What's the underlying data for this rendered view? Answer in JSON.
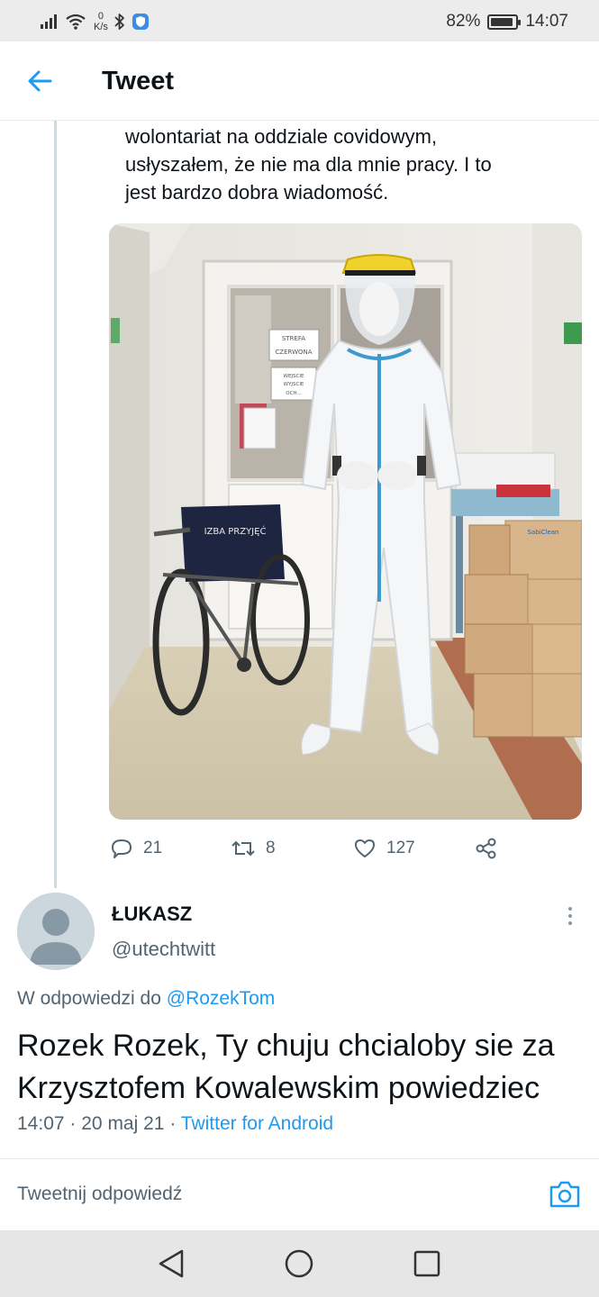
{
  "status_bar": {
    "netspeed_value": "0",
    "netspeed_unit": "K/s",
    "battery": "82%",
    "battery_level": 0.82,
    "time": "14:07",
    "icons": [
      "signal-icon",
      "wifi-icon",
      "bluetooth-icon",
      "shield-app-icon",
      "battery-icon"
    ]
  },
  "header": {
    "title": "Tweet",
    "back_icon": "arrow-left-icon"
  },
  "quoted_tweet": {
    "text_lines": [
      "wolontariat na oddziale covidowym,",
      "usłyszałem, że nie ma dla mnie pracy. I to",
      "jest bardzo dobra wiadomość."
    ],
    "photo": {
      "sign_1_lines": [
        "STREFA",
        "CZERWONA"
      ],
      "sign_2_lines": [
        "WEJSCIE",
        "WYJSCIE",
        "OCH..."
      ],
      "wheelchair_label": "IZBA PRZYJĘĆ",
      "box_label": "SabiClean"
    },
    "actions": {
      "replies": "21",
      "retweets": "8",
      "likes": "127"
    }
  },
  "reply_tweet": {
    "author_name": "ŁUKASZ",
    "author_handle": "@utechtwitt",
    "reply_prefix": "W odpowiedzi do",
    "reply_to": "@RozekTom",
    "text_lines": [
      "Rozek Rozek, Ty chuju chcialoby sie za",
      "Krzysztofem Kowalewskim powiedziec"
    ],
    "time": "14:07",
    "date": "20 maj 21",
    "source": "Twitter for Android",
    "separator": "·"
  },
  "composer": {
    "placeholder": "Tweetnij odpowiedź"
  },
  "colors": {
    "accent": "#1d9bf0",
    "text": "#0f1419",
    "secondary": "#536471",
    "thread_line": "#cfd9de"
  }
}
